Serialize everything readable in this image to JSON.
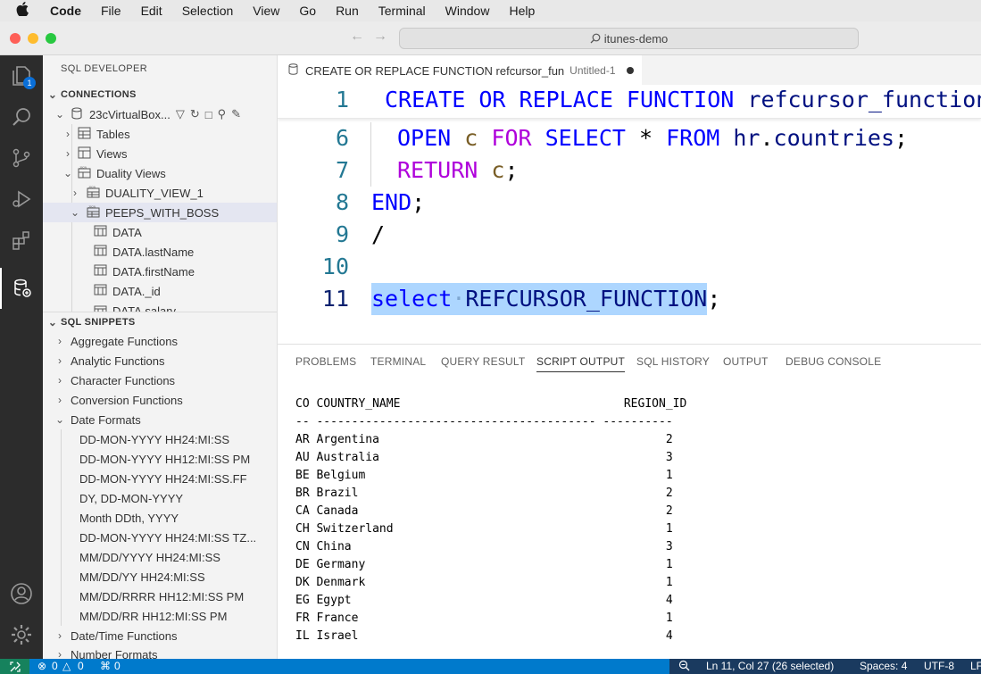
{
  "menubar": {
    "apple": "",
    "items": [
      "Code",
      "File",
      "Edit",
      "Selection",
      "View",
      "Go",
      "Run",
      "Terminal",
      "Window",
      "Help"
    ]
  },
  "titlebar": {
    "search": "itunes-demo"
  },
  "activity": {
    "badge": "1"
  },
  "sidebar": {
    "title": "SQL DEVELOPER",
    "connections_header": "CONNECTIONS",
    "connection_name": "23cVirtualBox...",
    "tree": [
      "Tables",
      "Views",
      "Duality Views",
      "DUALITY_VIEW_1",
      "PEEPS_WITH_BOSS",
      "DATA",
      "DATA.lastName",
      "DATA.firstName",
      "DATA._id",
      "DATA.salary"
    ],
    "snippets_header": "SQL SNIPPETS",
    "snippets": [
      "Aggregate Functions",
      "Analytic Functions",
      "Character Functions",
      "Conversion Functions",
      "Date Formats"
    ],
    "date_formats": [
      "DD-MON-YYYY HH24:MI:SS",
      "DD-MON-YYYY HH12:MI:SS PM",
      "DD-MON-YYYY HH24:MI:SS.FF",
      "DY, DD-MON-YYYY",
      "Month DDth, YYYY",
      "DD-MON-YYYY HH24:MI:SS TZ...",
      "MM/DD/YYYY HH24:MI:SS",
      "MM/DD/YY HH24:MI:SS",
      "MM/DD/RRRR HH12:MI:SS PM",
      "MM/DD/RR HH12:MI:SS PM"
    ],
    "more_snippets": [
      "Date/Time Functions",
      "Number Formats"
    ]
  },
  "editor": {
    "tab_title": "CREATE OR REPLACE FUNCTION refcursor_fun",
    "tab_desc": "Untitled-1",
    "lines": [
      {
        "n": "1",
        "tokens": [
          [
            "kw",
            "CREATE OR REPLACE FUNCTION"
          ],
          [
            "plain",
            " "
          ],
          [
            "id",
            "refcursor_function"
          ]
        ]
      },
      {
        "n": "6",
        "tokens": [
          [
            "kw",
            "OPEN"
          ],
          [
            "plain",
            " "
          ],
          [
            "var",
            "c"
          ],
          [
            "plain",
            " "
          ],
          [
            "kw2",
            "FOR"
          ],
          [
            "plain",
            " "
          ],
          [
            "kw",
            "SELECT"
          ],
          [
            "plain",
            " * "
          ],
          [
            "kw",
            "FROM"
          ],
          [
            "plain",
            " "
          ],
          [
            "id",
            "hr"
          ],
          [
            "plain",
            "."
          ],
          [
            "id",
            "countries"
          ],
          [
            "plain",
            ";"
          ]
        ]
      },
      {
        "n": "7",
        "tokens": [
          [
            "kw2",
            "RETURN"
          ],
          [
            "plain",
            " "
          ],
          [
            "var",
            "c"
          ],
          [
            "plain",
            ";"
          ]
        ]
      },
      {
        "n": "8",
        "tokens": [
          [
            "kw",
            "END"
          ],
          [
            "plain",
            ";"
          ]
        ]
      },
      {
        "n": "9",
        "tokens": [
          [
            "plain",
            "/"
          ]
        ]
      },
      {
        "n": "10",
        "tokens": []
      },
      {
        "n": "11",
        "tokens": [
          [
            "kw",
            "select"
          ],
          [
            "plain",
            "·"
          ],
          [
            "id",
            "REFCURSOR_FUNCTION"
          ],
          [
            "plain",
            ";"
          ]
        ]
      }
    ]
  },
  "panel": {
    "tabs": [
      "PROBLEMS",
      "TERMINAL",
      "QUERY RESULT",
      "SCRIPT OUTPUT",
      "SQL HISTORY",
      "OUTPUT",
      "DEBUG CONSOLE"
    ],
    "active_tab": "SCRIPT OUTPUT",
    "output_header": "CO COUNTRY_NAME                                REGION_ID",
    "output_rule": "-- ---------------------------------------- ----------",
    "rows": [
      {
        "co": "AR",
        "name": "Argentina",
        "region": "2"
      },
      {
        "co": "AU",
        "name": "Australia",
        "region": "3"
      },
      {
        "co": "BE",
        "name": "Belgium",
        "region": "1"
      },
      {
        "co": "BR",
        "name": "Brazil",
        "region": "2"
      },
      {
        "co": "CA",
        "name": "Canada",
        "region": "2"
      },
      {
        "co": "CH",
        "name": "Switzerland",
        "region": "1"
      },
      {
        "co": "CN",
        "name": "China",
        "region": "3"
      },
      {
        "co": "DE",
        "name": "Germany",
        "region": "1"
      },
      {
        "co": "DK",
        "name": "Denmark",
        "region": "1"
      },
      {
        "co": "EG",
        "name": "Egypt",
        "region": "4"
      },
      {
        "co": "FR",
        "name": "France",
        "region": "1"
      },
      {
        "co": "IL",
        "name": "Israel",
        "region": "4"
      }
    ]
  },
  "statusbar": {
    "errors": "0",
    "warnings": "0",
    "ports": "0",
    "position": "Ln 11, Col 27 (26 selected)",
    "spaces": "Spaces: 4",
    "encoding": "UTF-8",
    "eol": "LF"
  }
}
